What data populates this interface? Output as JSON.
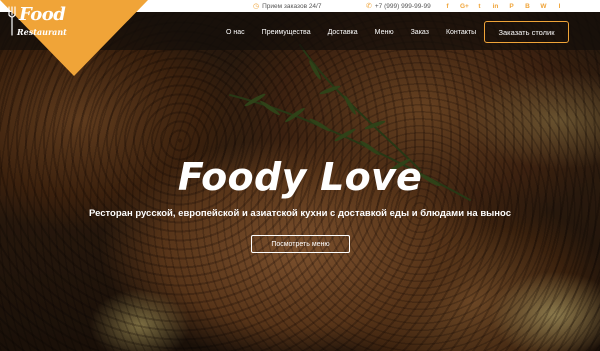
{
  "topbar": {
    "hours_icon": "clock-icon",
    "hours_text": "Прием заказов 24/7",
    "phone_icon": "phone-icon",
    "phone_text": "+7 (999) 999-99-99",
    "socials": [
      "f",
      "G+",
      "t",
      "in",
      "P",
      "B",
      "W",
      "I"
    ]
  },
  "logo": {
    "line1": "Food",
    "line2": "Restaurant"
  },
  "nav": {
    "items": [
      "О нас",
      "Преимущества",
      "Доставка",
      "Меню",
      "Заказ",
      "Контакты"
    ],
    "reserve_label": "Заказать столик"
  },
  "hero": {
    "title": "Foody Love",
    "subtitle": "Ресторан русской, европейской и азиатской кухни с доставкой еды и блюдами на вынос",
    "menu_button": "Посмотреть меню"
  },
  "colors": {
    "accent": "#f0a438",
    "topbar_bg": "#ffffff",
    "navbar_bg": "#140e0a"
  }
}
